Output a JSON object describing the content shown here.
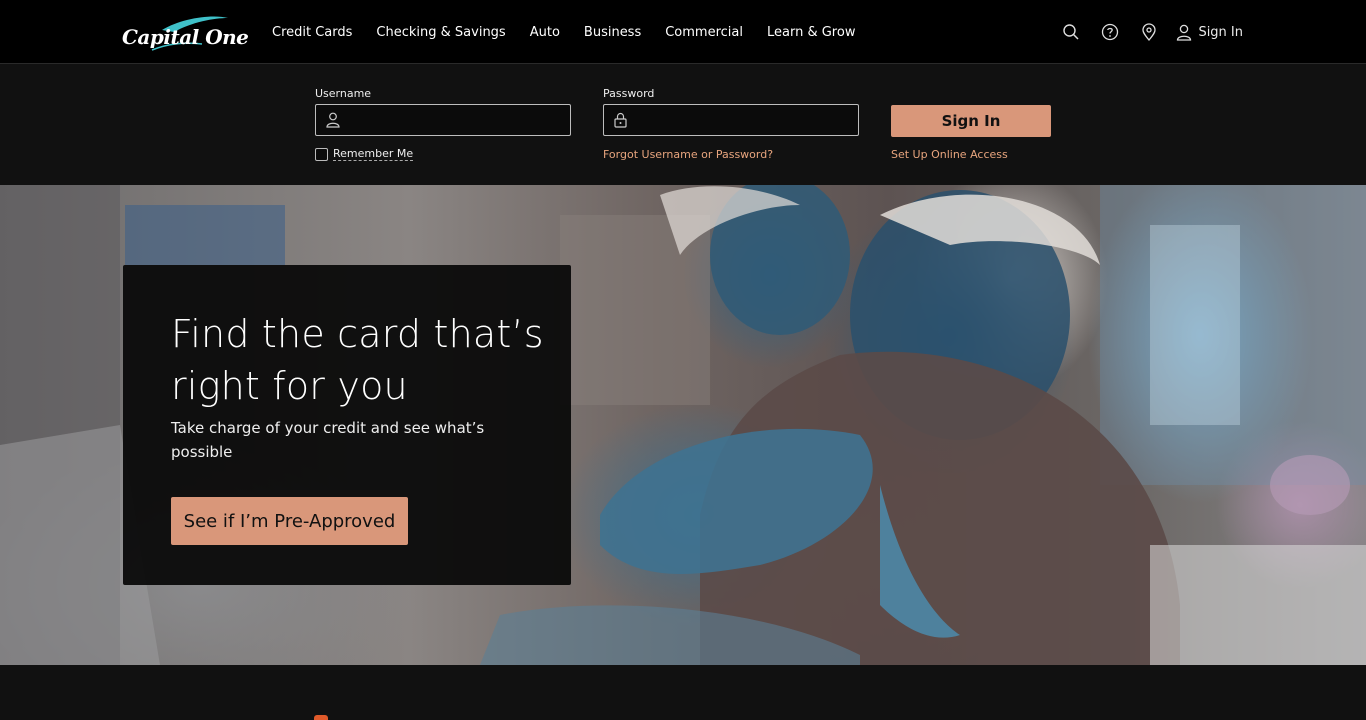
{
  "brand": {
    "name": "Capital One",
    "logo_text": "Capital One",
    "swoosh_color": "#3fc1c9"
  },
  "nav": {
    "links": [
      "Credit Cards",
      "Checking & Savings",
      "Auto",
      "Business",
      "Commercial",
      "Learn & Grow"
    ],
    "icons": [
      "search-icon",
      "help-icon",
      "location-pin-icon",
      "user-icon"
    ],
    "sign_in_label": "Sign In"
  },
  "login": {
    "username_label": "Username",
    "username_value": "",
    "password_label": "Password",
    "password_value": "",
    "remember_label": "Remember Me",
    "remember_checked": false,
    "forgot_label": "Forgot Username or Password?",
    "setup_label": "Set Up Online Access",
    "sign_in_button": "Sign In"
  },
  "hero": {
    "title": "Find the card that’s right for you",
    "subtitle": "Take charge of your credit and see what’s possible",
    "cta_label": "See if I’m Pre-Approved"
  },
  "colors": {
    "accent": "#d9977a",
    "link": "#e8a57e",
    "nav_bg": "#000000",
    "strip_bg": "#111111"
  }
}
